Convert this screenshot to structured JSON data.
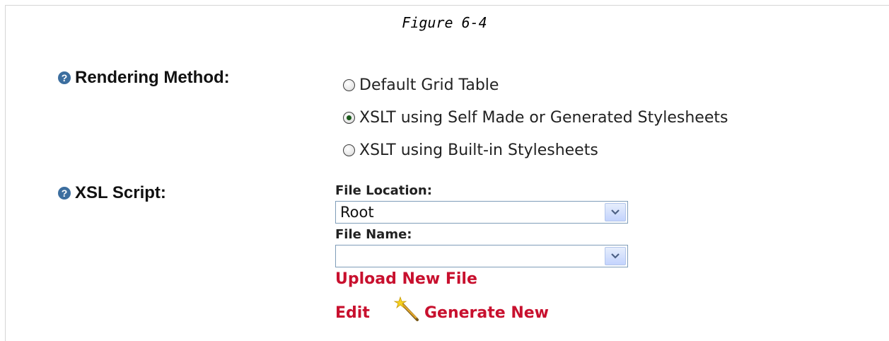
{
  "caption": "Figure 6-4",
  "rendering_method": {
    "label": "Rendering Method:",
    "help_icon": "question-circle-icon",
    "options": [
      {
        "label": "Default Grid Table",
        "checked": false
      },
      {
        "label": "XSLT using Self Made or Generated Stylesheets",
        "checked": true
      },
      {
        "label": "XSLT using Built-in Stylesheets",
        "checked": false
      }
    ]
  },
  "xsl_script": {
    "label": "XSL Script:",
    "help_icon": "question-circle-icon",
    "file_location_label": "File Location:",
    "file_location_value": "Root",
    "file_name_label": "File Name:",
    "file_name_value": "",
    "upload_link": "Upload New File",
    "edit_link": "Edit",
    "generate_link": "Generate New",
    "generate_icon": "magic-wand-icon"
  },
  "colors": {
    "link": "#c8102e",
    "help_icon": "#3c6e9f",
    "select_border": "#7f9db9"
  }
}
